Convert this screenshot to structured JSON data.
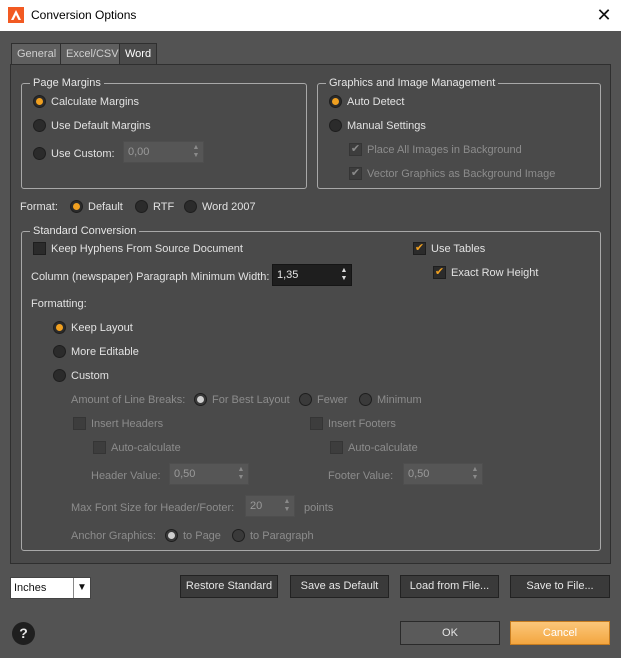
{
  "window": {
    "title": "Conversion Options",
    "close_glyph": "✕",
    "app_icon": "adobe-logo-icon"
  },
  "tabs": [
    {
      "label": "General"
    },
    {
      "label": "Excel/CSV"
    },
    {
      "label": "Word",
      "active": true
    }
  ],
  "page_margins": {
    "legend": "Page Margins",
    "calculate": "Calculate Margins",
    "use_default": "Use Default Margins",
    "use_custom": "Use Custom:",
    "custom_value": "0,00",
    "selected": "calculate"
  },
  "graphics": {
    "legend": "Graphics and Image Management",
    "auto_detect": "Auto Detect",
    "manual": "Manual Settings",
    "place_images": "Place All Images in Background",
    "vector_graphics": "Vector Graphics as Background Image",
    "selected": "auto_detect"
  },
  "format": {
    "label": "Format:",
    "default": "Default",
    "rtf": "RTF",
    "word2007": "Word 2007",
    "selected": "default"
  },
  "standard": {
    "legend": "Standard Conversion",
    "keep_hyphens": "Keep Hyphens From Source Document",
    "use_tables": "Use Tables",
    "exact_row_height": "Exact Row Height",
    "column_label": "Column (newspaper) Paragraph Minimum Width:",
    "column_value": "1,35",
    "formatting_label": "Formatting:",
    "keep_layout": "Keep Layout",
    "more_editable": "More Editable",
    "custom": "Custom",
    "line_breaks_label": "Amount of Line Breaks:",
    "for_best_layout": "For Best Layout",
    "fewer": "Fewer",
    "minimum": "Minimum",
    "insert_headers": "Insert Headers",
    "insert_footers": "Insert Footers",
    "auto_calc_1": "Auto-calculate",
    "auto_calc_2": "Auto-calculate",
    "header_value_label": "Header Value:",
    "header_value": "0,50",
    "footer_value_label": "Footer Value:",
    "footer_value": "0,50",
    "max_font_label": "Max Font Size for Header/Footer:",
    "max_font_value": "20",
    "points": "points",
    "anchor_label": "Anchor Graphics:",
    "to_page": "to Page",
    "to_paragraph": "to Paragraph",
    "check_glyph": "✔"
  },
  "bottom": {
    "units_value": "Inches",
    "restore": "Restore Standard",
    "save_default": "Save as Default",
    "load_file": "Load from File...",
    "save_file": "Save to File...",
    "help": "?",
    "ok": "OK",
    "cancel": "Cancel"
  },
  "colors": {
    "accent": "#f0a020",
    "background": "#535353",
    "panel": "#4a4a4a"
  }
}
